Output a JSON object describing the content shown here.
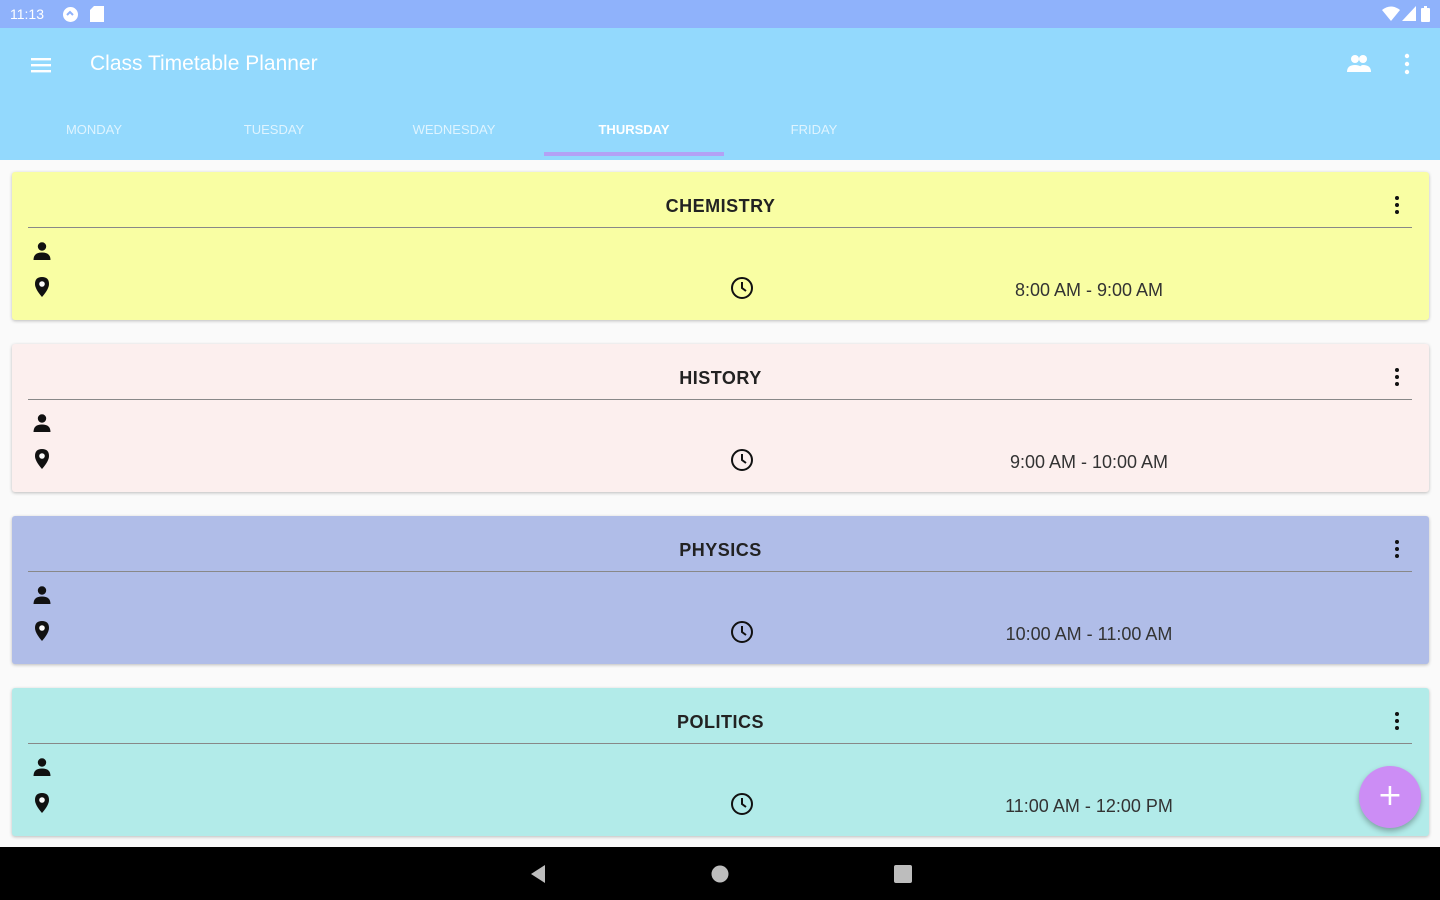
{
  "status_bar": {
    "time": "11:13"
  },
  "app_bar": {
    "title": "Class Timetable Planner"
  },
  "tabs": [
    {
      "label": "MONDAY"
    },
    {
      "label": "TUESDAY"
    },
    {
      "label": "WEDNESDAY"
    },
    {
      "label": "THURSDAY",
      "active": true
    },
    {
      "label": "FRIDAY"
    }
  ],
  "classes": [
    {
      "subject": "CHEMISTRY",
      "time": "8:00 AM - 9:00 AM",
      "color": "#f9fea3"
    },
    {
      "subject": "HISTORY",
      "time": "9:00 AM - 10:00 AM",
      "color": "#fcefee"
    },
    {
      "subject": "PHYSICS",
      "time": "10:00 AM - 11:00 AM",
      "color": "#b0bde8"
    },
    {
      "subject": "POLITICS",
      "time": "11:00 AM - 12:00 PM",
      "color": "#b2ebe9"
    }
  ],
  "fab": {
    "label": "+"
  },
  "colors": {
    "status_bar": "#8fb2fb",
    "app_bar": "#93d9fd",
    "tab_indicator": "#b3a1f5",
    "fab": "#cc8df5"
  },
  "icons": [
    "menu-icon",
    "people-icon",
    "more-vert-icon",
    "person-icon",
    "location-icon",
    "clock-icon",
    "back-icon",
    "home-icon",
    "recents-icon"
  ]
}
